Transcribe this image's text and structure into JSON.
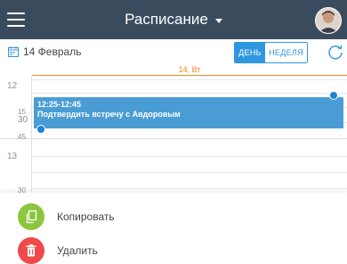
{
  "header": {
    "title": "Расписание"
  },
  "toolbar": {
    "date_label": "14 Февраль",
    "view_day": "ДЕНЬ",
    "view_week": "НЕДЕЛЯ"
  },
  "day_header": {
    "label": "14, Вт"
  },
  "time_labels": {
    "h12": "12",
    "m15": "15",
    "m30": "30",
    "m45": "45",
    "h13": "13",
    "m30b": "30"
  },
  "event": {
    "time": "12:25-12:45",
    "subject": "Подтвердить встречу с Авдоровым"
  },
  "actions": {
    "copy": "Копировать",
    "delete": "Удалить"
  },
  "colors": {
    "topbar": "#3b4b5e",
    "accent": "#2e97e0",
    "event": "#4a9dd4",
    "day_marker": "#f08a24",
    "copy": "#8cc63f",
    "delete": "#ee4a4a"
  }
}
